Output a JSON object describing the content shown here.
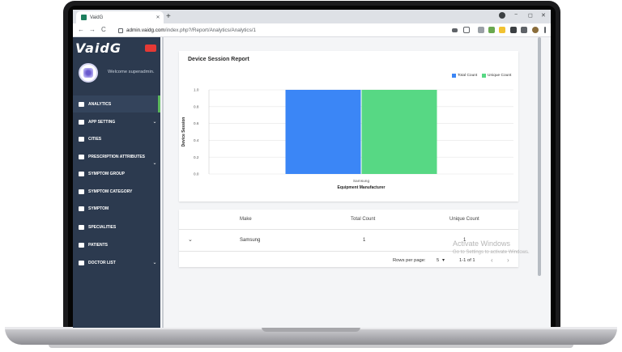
{
  "browser": {
    "tab_title": "VaidG",
    "tab_close": "✕",
    "new_tab": "+",
    "url_host": "admin.vaidg.com",
    "url_path": "/index.php?/Report/Analytics/Analytics/1",
    "back": "←",
    "forward": "→",
    "reload": "C",
    "minimize": "−",
    "maximize": "◻",
    "close": "✕"
  },
  "sidebar": {
    "logo": "VaidG",
    "welcome": "Welcome superadmin.",
    "items": [
      {
        "label": "ANALYTICS",
        "icon": "dashboard-icon",
        "chevron": ""
      },
      {
        "label": "APP SETTING",
        "icon": "cogs-icon",
        "chevron": "⌄"
      },
      {
        "label": "CITIES",
        "icon": "building-icon",
        "chevron": ""
      },
      {
        "label": "PRESCRIPTION ATTRIBUTES",
        "icon": "cogs-icon",
        "chevron": "⌄"
      },
      {
        "label": "SYMPTOM GROUP",
        "icon": "dna-icon",
        "chevron": ""
      },
      {
        "label": "SYMPTOM CATEGORY",
        "icon": "syringe-icon",
        "chevron": ""
      },
      {
        "label": "SYMPTOM",
        "icon": "flask-icon",
        "chevron": ""
      },
      {
        "label": "SPECIALITIES",
        "icon": "grid-icon",
        "chevron": ""
      },
      {
        "label": "PATIENTS",
        "icon": "user-icon",
        "chevron": ""
      },
      {
        "label": "DOCTOR LIST",
        "icon": "doctor-icon",
        "chevron": "⌄"
      }
    ]
  },
  "report": {
    "title": "Device Session Report"
  },
  "chart_data": {
    "type": "bar",
    "title": "Device Session Report",
    "categories": [
      "Samsung"
    ],
    "series": [
      {
        "name": "Total Count",
        "values": [
          1
        ],
        "color": "#3b86f6"
      },
      {
        "name": "Unique Count",
        "values": [
          1
        ],
        "color": "#57d884"
      }
    ],
    "xlabel": "Equipment Manufacturer",
    "ylabel": "Device Session",
    "ylim": [
      0,
      1
    ],
    "yticks": [
      "0.0",
      "0.2",
      "0.4",
      "0.6",
      "0.8",
      "1.0"
    ],
    "grid": true,
    "legend": "top-right"
  },
  "table": {
    "headers": [
      "Make",
      "Total Count",
      "Unique Count"
    ],
    "rows": [
      {
        "make": "Samsung",
        "total": "1",
        "unique": "1"
      }
    ],
    "expand_icon": "⌄",
    "rows_per_page_label": "Rows per page:",
    "rows_per_page_value": "5",
    "rows_per_page_caret": "▾",
    "range": "1-1 of 1",
    "prev": "‹",
    "next": "›"
  },
  "watermark": {
    "line1": "Activate Windows",
    "line2": "Go to Settings to activate Windows."
  }
}
